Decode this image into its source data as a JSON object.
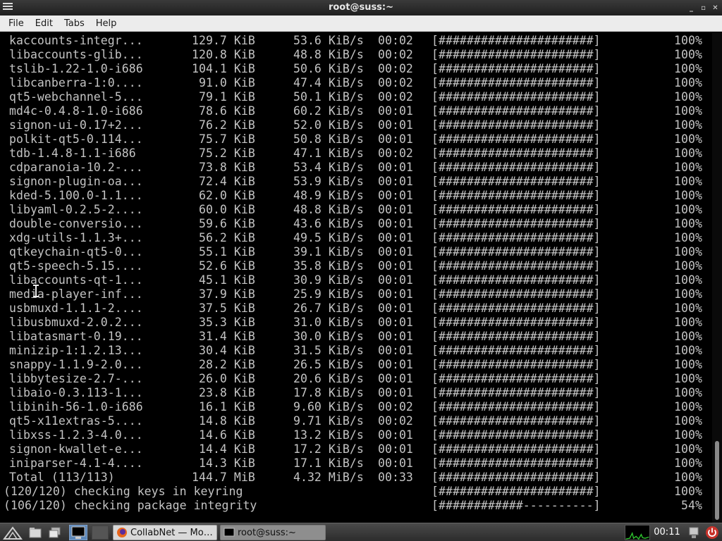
{
  "window": {
    "title": "root@suss:~"
  },
  "menu": [
    "File",
    "Edit",
    "Tabs",
    "Help"
  ],
  "terminal": {
    "rows": [
      {
        "name": "kaccounts-integr...",
        "size": "129.7 KiB",
        "rate": " 53.6 KiB/s",
        "time": "00:02",
        "bar": "[######################]",
        "pct": "100%"
      },
      {
        "name": "libaccounts-glib...",
        "size": "120.8 KiB",
        "rate": " 48.8 KiB/s",
        "time": "00:02",
        "bar": "[######################]",
        "pct": "100%"
      },
      {
        "name": "tslib-1.22-1.0-i686",
        "size": "104.1 KiB",
        "rate": " 50.6 KiB/s",
        "time": "00:02",
        "bar": "[######################]",
        "pct": "100%"
      },
      {
        "name": "libcanberra-1:0....",
        "size": " 91.0 KiB",
        "rate": " 47.4 KiB/s",
        "time": "00:02",
        "bar": "[######################]",
        "pct": "100%"
      },
      {
        "name": "qt5-webchannel-5...",
        "size": " 79.1 KiB",
        "rate": " 50.1 KiB/s",
        "time": "00:02",
        "bar": "[######################]",
        "pct": "100%"
      },
      {
        "name": "md4c-0.4.8-1.0-i686",
        "size": " 78.6 KiB",
        "rate": " 60.2 KiB/s",
        "time": "00:01",
        "bar": "[######################]",
        "pct": "100%"
      },
      {
        "name": "signon-ui-0.17+2...",
        "size": " 76.2 KiB",
        "rate": " 52.0 KiB/s",
        "time": "00:01",
        "bar": "[######################]",
        "pct": "100%"
      },
      {
        "name": "polkit-qt5-0.114...",
        "size": " 75.7 KiB",
        "rate": " 50.8 KiB/s",
        "time": "00:01",
        "bar": "[######################]",
        "pct": "100%"
      },
      {
        "name": "tdb-1.4.8-1.1-i686",
        "size": " 75.2 KiB",
        "rate": " 47.1 KiB/s",
        "time": "00:02",
        "bar": "[######################]",
        "pct": "100%"
      },
      {
        "name": "cdparanoia-10.2-...",
        "size": " 73.8 KiB",
        "rate": " 53.4 KiB/s",
        "time": "00:01",
        "bar": "[######################]",
        "pct": "100%"
      },
      {
        "name": "signon-plugin-oa...",
        "size": " 72.4 KiB",
        "rate": " 53.9 KiB/s",
        "time": "00:01",
        "bar": "[######################]",
        "pct": "100%"
      },
      {
        "name": "kded-5.100.0-1.1...",
        "size": " 62.0 KiB",
        "rate": " 48.9 KiB/s",
        "time": "00:01",
        "bar": "[######################]",
        "pct": "100%"
      },
      {
        "name": "libyaml-0.2.5-2....",
        "size": " 60.0 KiB",
        "rate": " 48.8 KiB/s",
        "time": "00:01",
        "bar": "[######################]",
        "pct": "100%"
      },
      {
        "name": "double-conversio...",
        "size": " 59.6 KiB",
        "rate": " 43.6 KiB/s",
        "time": "00:01",
        "bar": "[######################]",
        "pct": "100%"
      },
      {
        "name": "xdg-utils-1.1.3+...",
        "size": " 56.2 KiB",
        "rate": " 49.5 KiB/s",
        "time": "00:01",
        "bar": "[######################]",
        "pct": "100%"
      },
      {
        "name": "qtkeychain-qt5-0...",
        "size": " 55.1 KiB",
        "rate": " 39.1 KiB/s",
        "time": "00:01",
        "bar": "[######################]",
        "pct": "100%"
      },
      {
        "name": "qt5-speech-5.15....",
        "size": " 52.6 KiB",
        "rate": " 35.8 KiB/s",
        "time": "00:01",
        "bar": "[######################]",
        "pct": "100%"
      },
      {
        "name": "libaccounts-qt-1...",
        "size": " 45.1 KiB",
        "rate": " 30.9 KiB/s",
        "time": "00:01",
        "bar": "[######################]",
        "pct": "100%"
      },
      {
        "name": "media-player-inf...",
        "size": " 37.9 KiB",
        "rate": " 25.9 KiB/s",
        "time": "00:01",
        "bar": "[######################]",
        "pct": "100%"
      },
      {
        "name": "usbmuxd-1.1.1-2....",
        "size": " 37.5 KiB",
        "rate": " 26.7 KiB/s",
        "time": "00:01",
        "bar": "[######################]",
        "pct": "100%"
      },
      {
        "name": "libusbmuxd-2.0.2...",
        "size": " 35.3 KiB",
        "rate": " 31.0 KiB/s",
        "time": "00:01",
        "bar": "[######################]",
        "pct": "100%"
      },
      {
        "name": "libatasmart-0.19...",
        "size": " 31.4 KiB",
        "rate": " 30.0 KiB/s",
        "time": "00:01",
        "bar": "[######################]",
        "pct": "100%"
      },
      {
        "name": "minizip-1:1.2.13...",
        "size": " 30.4 KiB",
        "rate": " 31.5 KiB/s",
        "time": "00:01",
        "bar": "[######################]",
        "pct": "100%"
      },
      {
        "name": "snappy-1.1.9-2.0...",
        "size": " 28.2 KiB",
        "rate": " 26.5 KiB/s",
        "time": "00:01",
        "bar": "[######################]",
        "pct": "100%"
      },
      {
        "name": "libbytesize-2.7-...",
        "size": " 26.0 KiB",
        "rate": " 20.6 KiB/s",
        "time": "00:01",
        "bar": "[######################]",
        "pct": "100%"
      },
      {
        "name": "libaio-0.3.113-1...",
        "size": " 23.8 KiB",
        "rate": " 17.8 KiB/s",
        "time": "00:01",
        "bar": "[######################]",
        "pct": "100%"
      },
      {
        "name": "libinih-56-1.0-i686",
        "size": " 16.1 KiB",
        "rate": " 9.60 KiB/s",
        "time": "00:02",
        "bar": "[######################]",
        "pct": "100%"
      },
      {
        "name": "qt5-x11extras-5....",
        "size": " 14.8 KiB",
        "rate": " 9.71 KiB/s",
        "time": "00:02",
        "bar": "[######################]",
        "pct": "100%"
      },
      {
        "name": "libxss-1.2.3-4.0...",
        "size": " 14.6 KiB",
        "rate": " 13.2 KiB/s",
        "time": "00:01",
        "bar": "[######################]",
        "pct": "100%"
      },
      {
        "name": "signon-kwallet-e...",
        "size": " 14.4 KiB",
        "rate": " 17.2 KiB/s",
        "time": "00:01",
        "bar": "[######################]",
        "pct": "100%"
      },
      {
        "name": "iniparser-4.1-4....",
        "size": " 14.3 KiB",
        "rate": " 17.1 KiB/s",
        "time": "00:01",
        "bar": "[######################]",
        "pct": "100%"
      }
    ],
    "total": {
      "name": "Total (113/113)",
      "size": "144.7 MiB",
      "rate": " 4.32 MiB/s",
      "time": "00:33",
      "bar": "[######################]",
      "pct": "100%"
    },
    "checks": [
      {
        "text": "(120/120) checking keys in keyring",
        "bar": "[######################]",
        "pct": "100%"
      },
      {
        "text": "(106/120) checking package integrity",
        "bar": "[############----------]",
        "pct": " 54%"
      }
    ]
  },
  "taskbar": {
    "tasks": [
      {
        "label": "CollabNet — Mo…"
      },
      {
        "label": "root@suss:~"
      }
    ],
    "clock": "00:11"
  },
  "colors": {
    "terminal_bg": "#000000",
    "terminal_fg": "#c4c4c4",
    "taskbar_bg": "#3a3a3a",
    "titlebar_bg": "#2a2a2a",
    "menubar_bg": "#ececec"
  }
}
